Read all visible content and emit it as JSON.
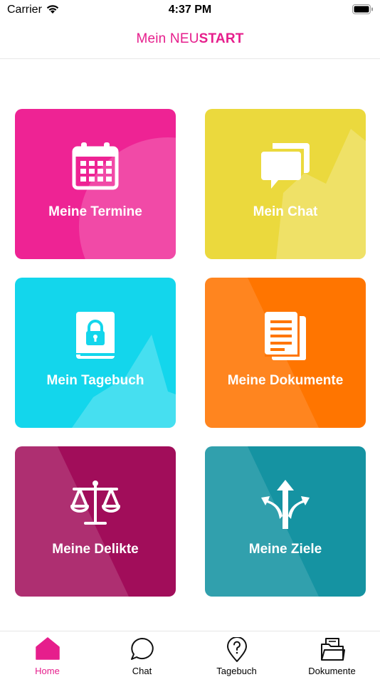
{
  "status_bar": {
    "carrier": "Carrier",
    "time": "4:37 PM"
  },
  "header": {
    "title_light": "Mein NEU",
    "title_bold": "START",
    "accent_color": "#e61e8c"
  },
  "tiles": [
    {
      "label": "Meine Termine",
      "icon": "calendar-icon",
      "color": "#ee2394"
    },
    {
      "label": "Mein Chat",
      "icon": "chat-bubbles-icon",
      "color": "#ebd93d"
    },
    {
      "label": "Mein Tagebuch",
      "icon": "locked-diary-icon",
      "color": "#13d6ec"
    },
    {
      "label": "Meine Dokumente",
      "icon": "documents-icon",
      "color": "#ff7500"
    },
    {
      "label": "Meine Delikte",
      "icon": "scales-icon",
      "color": "#a10d5a"
    },
    {
      "label": "Meine Ziele",
      "icon": "split-arrows-icon",
      "color": "#1593a2"
    }
  ],
  "tab_bar": {
    "active_color": "#e61e8c",
    "tabs": [
      {
        "label": "Home",
        "icon": "home-icon",
        "active": true
      },
      {
        "label": "Chat",
        "icon": "chat-icon",
        "active": false
      },
      {
        "label": "Tagebuch",
        "icon": "location-question-icon",
        "active": false
      },
      {
        "label": "Dokumente",
        "icon": "folder-icon",
        "active": false
      }
    ]
  }
}
